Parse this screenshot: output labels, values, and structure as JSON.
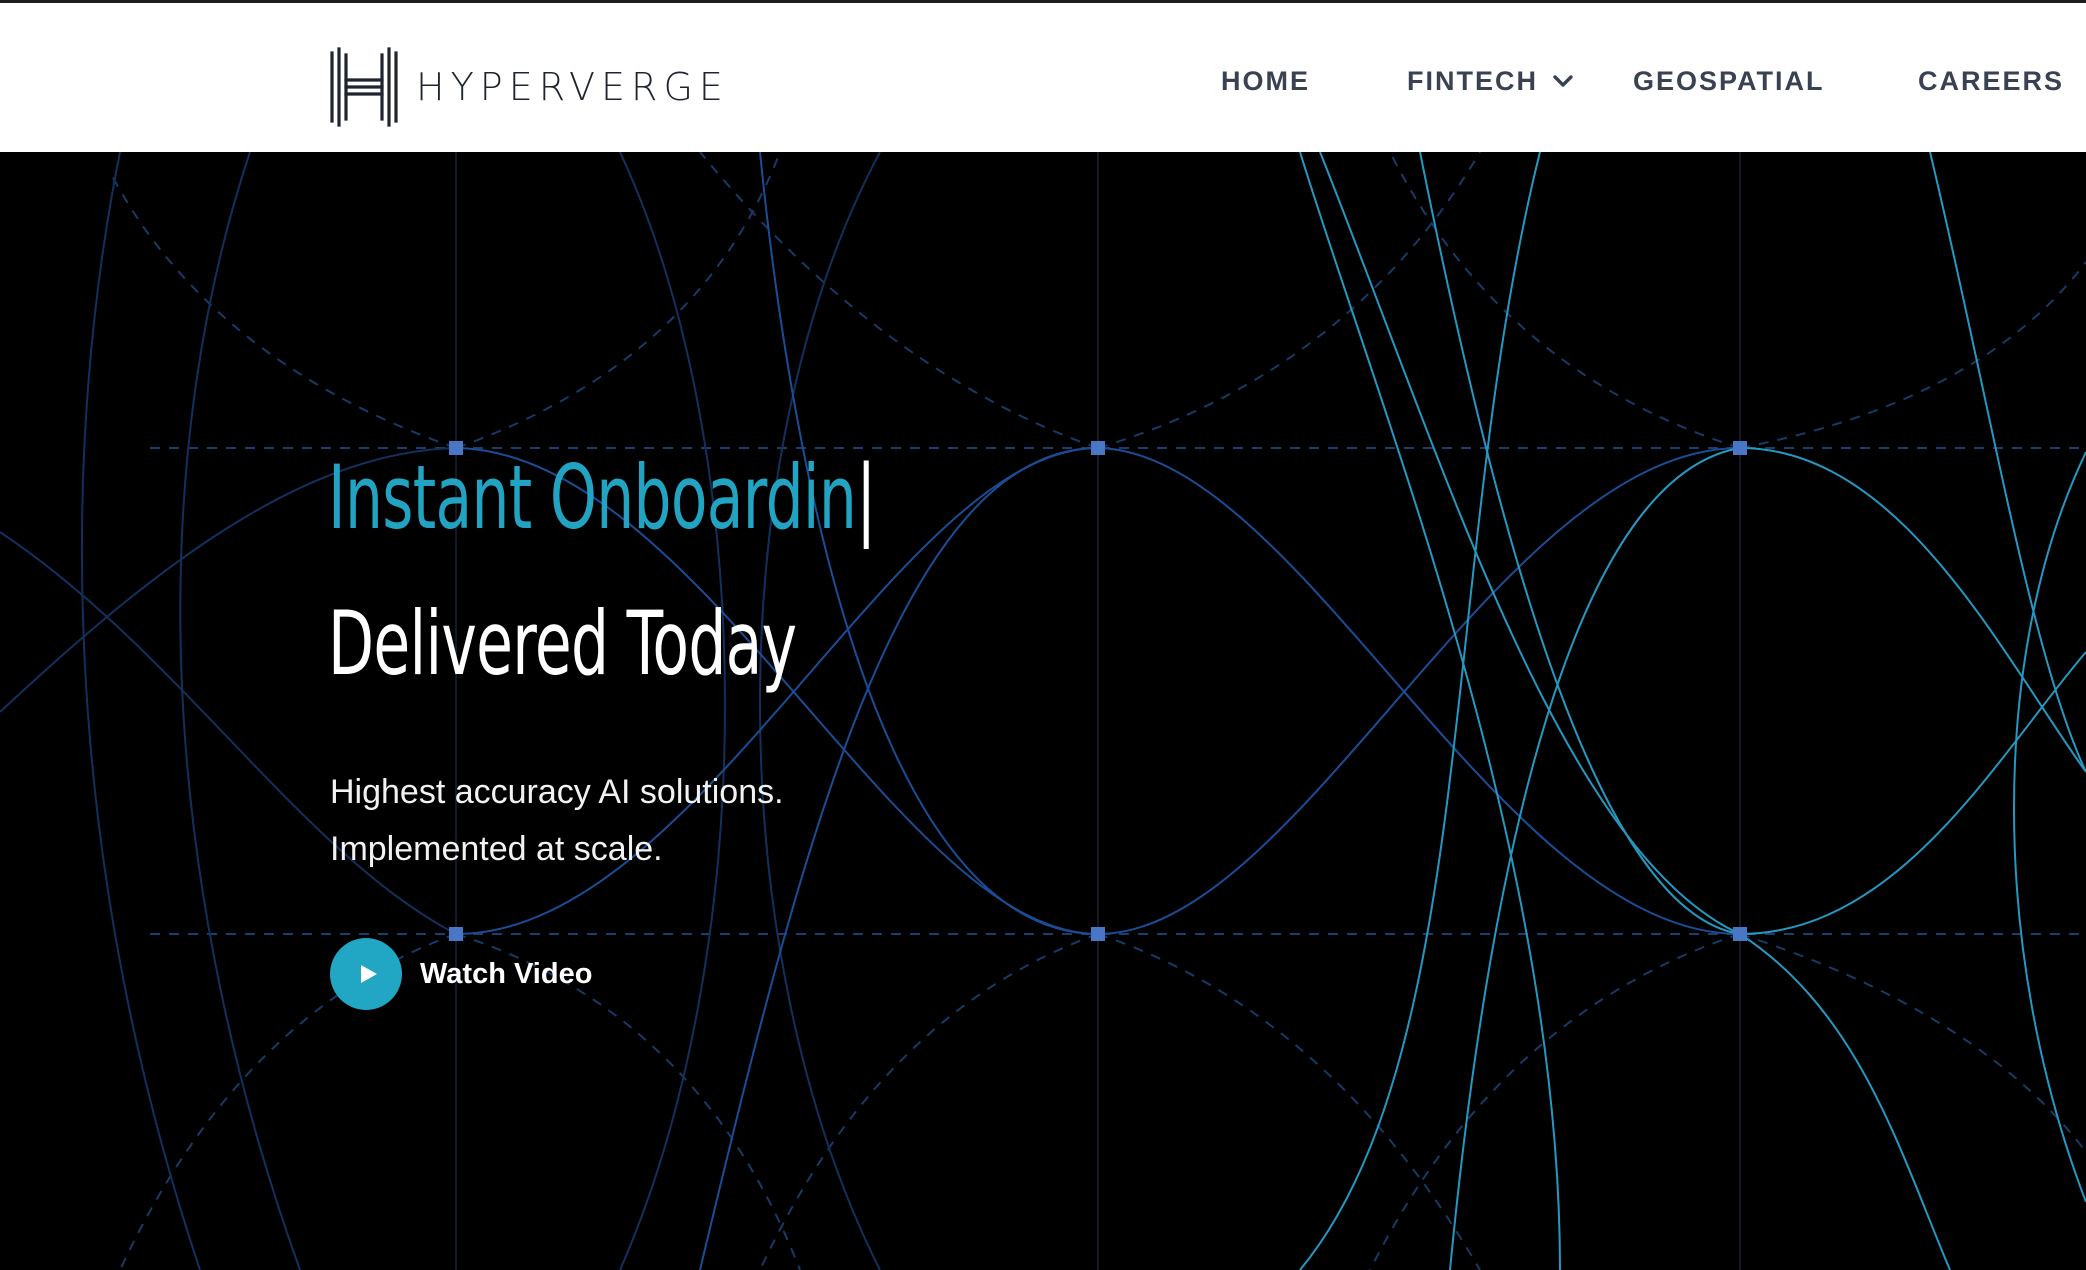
{
  "brand": {
    "name": "HYPERVERGE",
    "logo_icon": "hyperverge-h-logo"
  },
  "nav": {
    "items": [
      {
        "label": "HOME"
      },
      {
        "label": "FINTECH",
        "icon": "chevron-down-icon"
      },
      {
        "label": "GEOSPATIAL"
      },
      {
        "label": "CAREERS"
      }
    ]
  },
  "hero": {
    "headline_typing": "Instant Onboardin",
    "caret": "|",
    "headline_line2": "Delivered Today",
    "subtext_line1": "Highest accuracy AI solutions.",
    "subtext_line2": "Implemented at scale.",
    "cta_label": "Watch Video",
    "cta_icon": "play-icon"
  },
  "colors": {
    "accent": "#22a3c2",
    "hero_background": "#000000",
    "header_background": "#ffffff",
    "nav_text": "#3a4252",
    "line_dark_blue": "#1b4f9c",
    "line_cyan": "#2aa6cf",
    "node_blue": "#4a76c6"
  }
}
